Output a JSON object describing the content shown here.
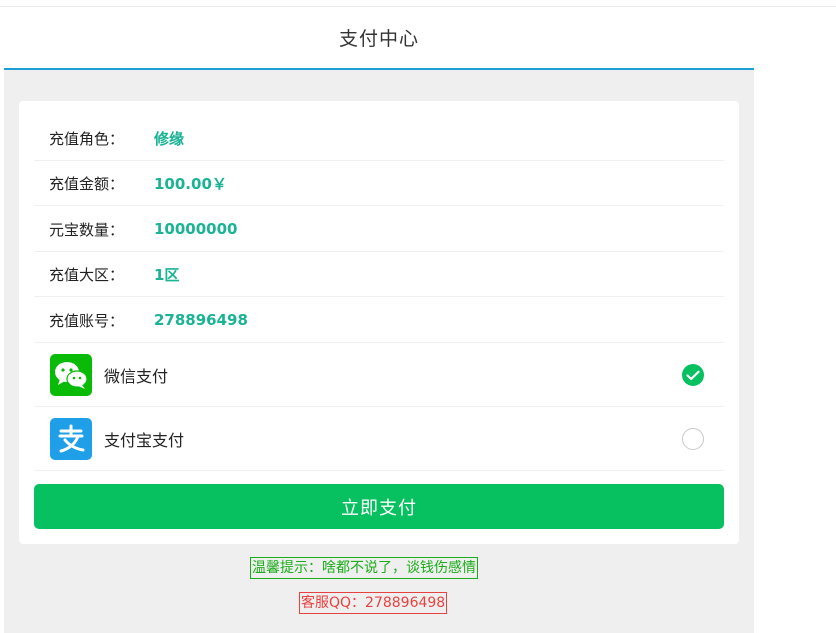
{
  "header": {
    "title": "支付中心"
  },
  "info": {
    "rows": [
      {
        "label": "充值角色：",
        "value": "修缘"
      },
      {
        "label": "充值金额：",
        "value": "100.00￥"
      },
      {
        "label": "元宝数量：",
        "value": "10000000"
      },
      {
        "label": "充值大区：",
        "value": "1区"
      },
      {
        "label": "充值账号：",
        "value": "278896498"
      }
    ]
  },
  "payment": {
    "options": [
      {
        "label": "微信支付",
        "icon": "wechat-icon",
        "selected": true,
        "color": "#09bb07"
      },
      {
        "label": "支付宝支付",
        "icon": "alipay-icon",
        "selected": false,
        "color": "#1e9fe8"
      }
    ]
  },
  "actions": {
    "pay_label": "立即支付"
  },
  "footer": {
    "tip": "温馨提示：啥都不说了，谈钱伤感情",
    "qq": "客服QQ：278896498"
  },
  "colors": {
    "accent_green": "#07c160",
    "value_teal": "#1ab394",
    "header_underline": "#1a9fd6",
    "tip_green": "#1aad19",
    "qq_red": "#e64340"
  }
}
